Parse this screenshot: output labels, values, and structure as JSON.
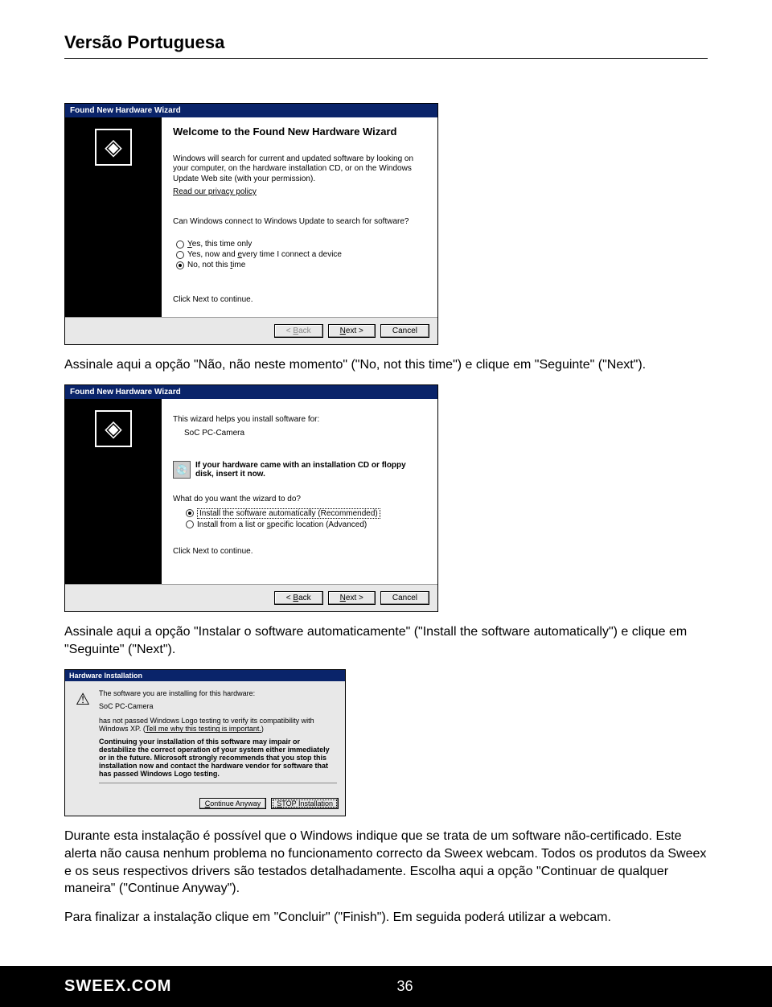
{
  "header": {
    "title": "Versão Portuguesa"
  },
  "wizard1": {
    "titlebar": "Found New Hardware Wizard",
    "heading": "Welcome to the Found New Hardware Wizard",
    "intro": "Windows will search for current and updated software by looking on your computer, on the hardware installation CD, or on the Windows Update Web site (with your permission).",
    "privacy_link": "Read our privacy policy",
    "question": "Can Windows connect to Windows Update to search for software?",
    "opt1": "Yes, this time only",
    "opt2": "Yes, now and every time I connect a device",
    "opt3": "No, not this time",
    "click_next": "Click Next to continue.",
    "btn_back": "< Back",
    "btn_next": "Next >",
    "btn_cancel": "Cancel"
  },
  "text1": "Assinale aqui a opção \"Não, não neste momento\" (\"No, not this time\") e clique em \"Seguinte\" (\"Next\").",
  "wizard2": {
    "titlebar": "Found New Hardware Wizard",
    "helps": "This wizard helps you install software for:",
    "device": "SoC PC-Camera",
    "cd_prompt": "If your hardware came with an installation CD or floppy disk, insert it now.",
    "question": "What do you want the wizard to do?",
    "opt1": "Install the software automatically (Recommended)",
    "opt2": "Install from a list or specific location (Advanced)",
    "click_next": "Click Next to continue.",
    "btn_back": "< Back",
    "btn_next": "Next >",
    "btn_cancel": "Cancel"
  },
  "text2": "Assinale aqui a opção \"Instalar o software automaticamente\" (\"Install the software automatically\") e clique em \"Seguinte\" (\"Next\").",
  "warn": {
    "titlebar": "Hardware Installation",
    "line1": "The software you are installing for this hardware:",
    "device": "SoC PC-Camera",
    "line2a": "has not passed Windows Logo testing to verify its compatibility with Windows XP. (",
    "line2b": "Tell me why this testing is important.",
    "line2c": ")",
    "bold1": "Continuing your installation of this software may impair or destabilize the correct operation of your system either immediately or in the future. Microsoft strongly recommends that you stop this installation now and contact the hardware vendor for software that has passed Windows Logo testing.",
    "btn_continue": "Continue Anyway",
    "btn_stop": "STOP Installation"
  },
  "text3": "Durante esta instalação é possível que o Windows indique que se trata de um software não-certificado. Este alerta não causa nenhum problema no funcionamento correcto da Sweex webcam. Todos os produtos da Sweex e os seus respectivos drivers são testados detalhadamente. Escolha aqui a opção \"Continuar de qualquer maneira\" (\"Continue Anyway\").",
  "text4": "Para finalizar a instalação clique em \"Concluir\" (\"Finish\"). Em seguida poderá utilizar a webcam.",
  "footer": {
    "brand": "SWEEX.COM",
    "page": "36"
  }
}
